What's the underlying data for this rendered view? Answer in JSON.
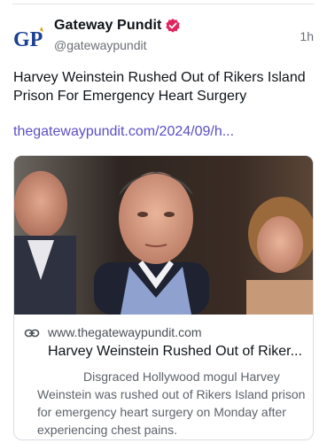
{
  "post": {
    "author_name": "Gateway Pundit",
    "author_handle": "@gatewaypundit",
    "timestamp": "1h",
    "avatar_text": "GP",
    "text": "Harvey Weinstein Rushed Out of Rikers Island Prison For Emergency Heart Surgery",
    "link_text": "thegatewaypundit.com/2024/09/h...",
    "verified_icon": "verified-badge-icon"
  },
  "card": {
    "domain": "www.thegatewaypundit.com",
    "title": "Harvey Weinstein Rushed Out of Riker...",
    "description": "Disgraced Hollywood mogul Harvey Weinstein was rushed out of Rikers Island prison for emergency heart surgery on Monday after experiencing chest pains.",
    "link_icon": "link-icon"
  },
  "colors": {
    "link": "#5b4fc7",
    "verified": "#e0245e",
    "avatar_blue": "#1c3f94",
    "avatar_gold": "#d4a017"
  }
}
